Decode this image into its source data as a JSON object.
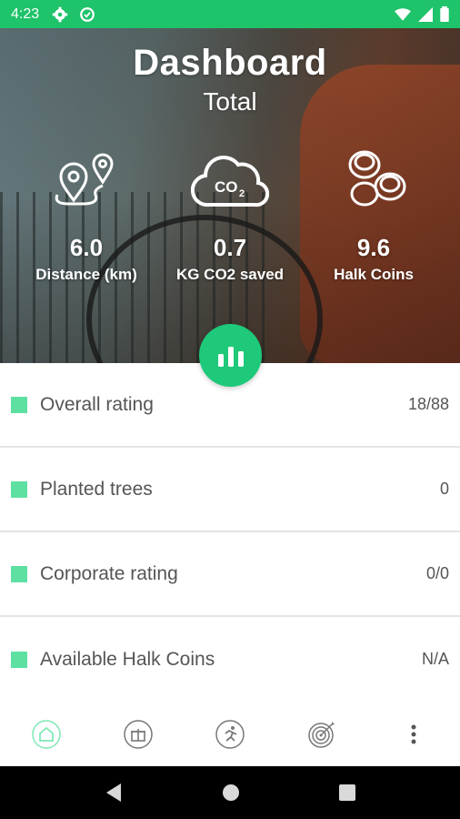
{
  "status_bar": {
    "time": "4:23"
  },
  "hero": {
    "title": "Dashboard",
    "subtitle": "Total",
    "stats": [
      {
        "icon": "route-pin-icon",
        "value": "6.0",
        "label": "Distance (km)"
      },
      {
        "icon": "co2-cloud-icon",
        "value": "0.7",
        "label": "KG CO2 saved"
      },
      {
        "icon": "coins-icon",
        "value": "9.6",
        "label": "Halk Coins"
      }
    ],
    "co2_icon_text": "CO"
  },
  "list": [
    {
      "label": "Overall rating",
      "value": "18/88"
    },
    {
      "label": "Planted trees",
      "value": "0"
    },
    {
      "label": "Corporate rating",
      "value": "0/0"
    },
    {
      "label": "Available Halk Coins",
      "value": "N/A"
    }
  ],
  "colors": {
    "accent": "#1ec36a",
    "marker": "#5ee0a2",
    "fab": "#1ec97a"
  },
  "bottom_nav": [
    "home-icon",
    "gift-icon",
    "runner-icon",
    "target-icon",
    "more-icon"
  ]
}
